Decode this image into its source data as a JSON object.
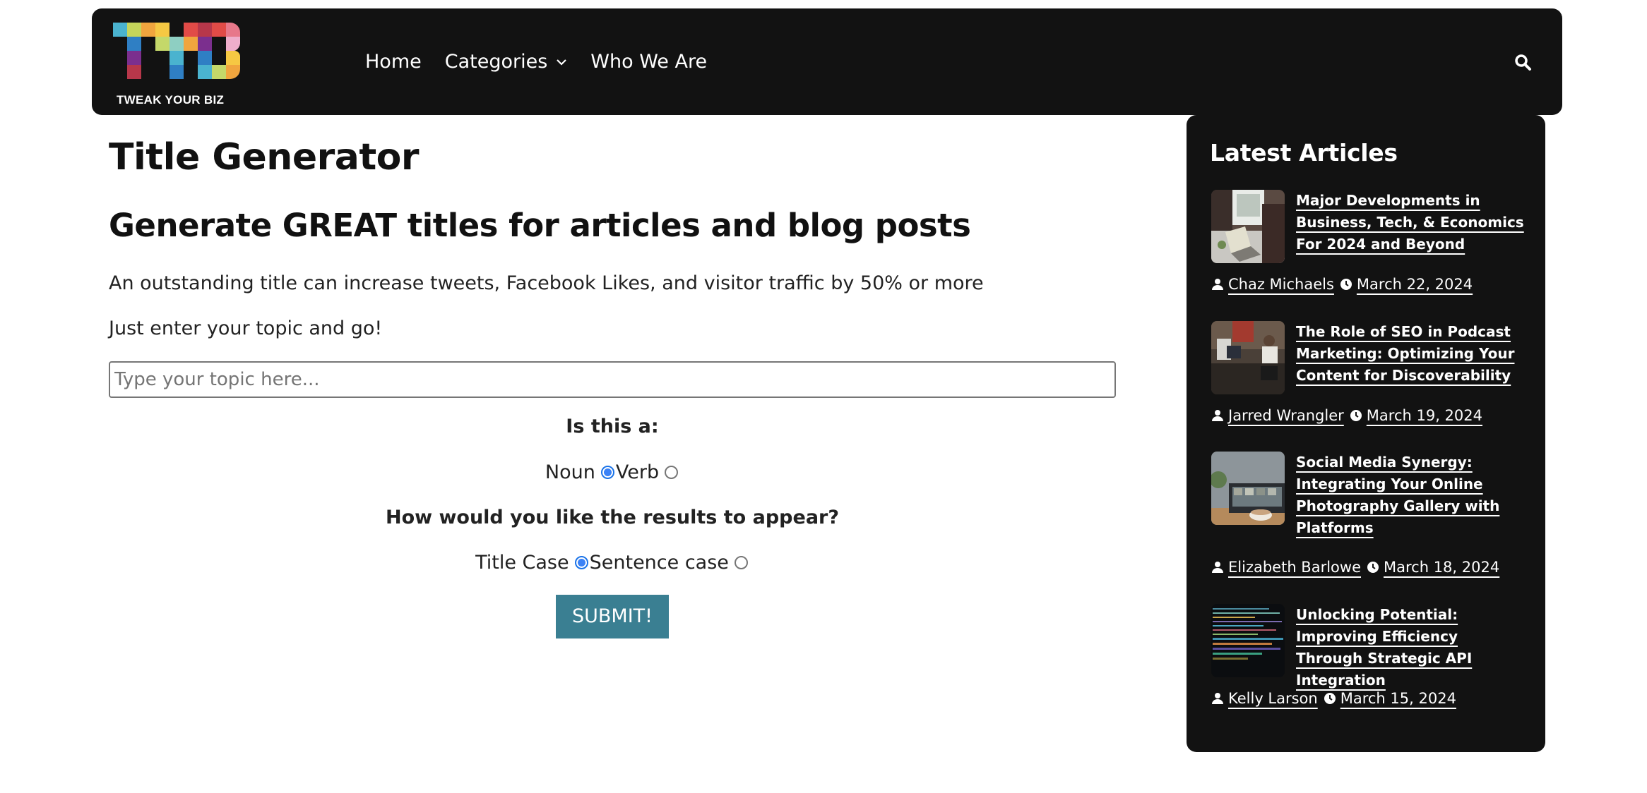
{
  "header": {
    "logo_text": "TWEAK YOUR BIZ",
    "logo_mark": "TYB",
    "nav": [
      {
        "label": "Home",
        "has_dropdown": false
      },
      {
        "label": "Categories",
        "has_dropdown": true
      },
      {
        "label": "Who We Are",
        "has_dropdown": false
      }
    ],
    "search_icon": "search-icon",
    "background": "#121212"
  },
  "main": {
    "title": "Title Generator",
    "subtitle": "Generate GREAT titles for articles and blog posts",
    "intro": "An outstanding title can increase tweets, Facebook Likes, and visitor traffic by 50% or more",
    "instruction": "Just enter your topic and go!",
    "topic_input": {
      "value": "",
      "placeholder": "Type your topic here..."
    },
    "word_type": {
      "question": "Is this a:",
      "options": [
        {
          "label": "Noun",
          "checked": true
        },
        {
          "label": "Verb",
          "checked": false
        }
      ]
    },
    "case_type": {
      "question": "How would you like the results to appear?",
      "options": [
        {
          "label": "Title Case",
          "checked": true
        },
        {
          "label": "Sentence case",
          "checked": false
        }
      ]
    },
    "submit_label": "SUBMIT!",
    "submit_color": "#3a7f92"
  },
  "sidebar": {
    "title": "Latest Articles",
    "articles": [
      {
        "title": "Major Developments in Business, Tech, & Economics For 2024 and Beyond",
        "author": "Chaz Michaels",
        "date": "March 22, 2024",
        "thumbnail": "laptop-by-window-image"
      },
      {
        "title": "The Role of SEO in Podcast Marketing: Optimizing Your Content for Discoverability",
        "author": "Jarred Wrangler",
        "date": "March 19, 2024",
        "thumbnail": "podcast-studio-image"
      },
      {
        "title": "Social Media Synergy: Integrating Your Online Photography Gallery with Platforms",
        "author": "Elizabeth Barlowe",
        "date": "March 18, 2024",
        "thumbnail": "laptop-and-coffee-image"
      },
      {
        "title": "Unlocking Potential: Improving Efficiency Through Strategic API Integration",
        "author": "Kelly Larson",
        "date": "March 15, 2024",
        "thumbnail": "code-screen-image"
      }
    ]
  }
}
